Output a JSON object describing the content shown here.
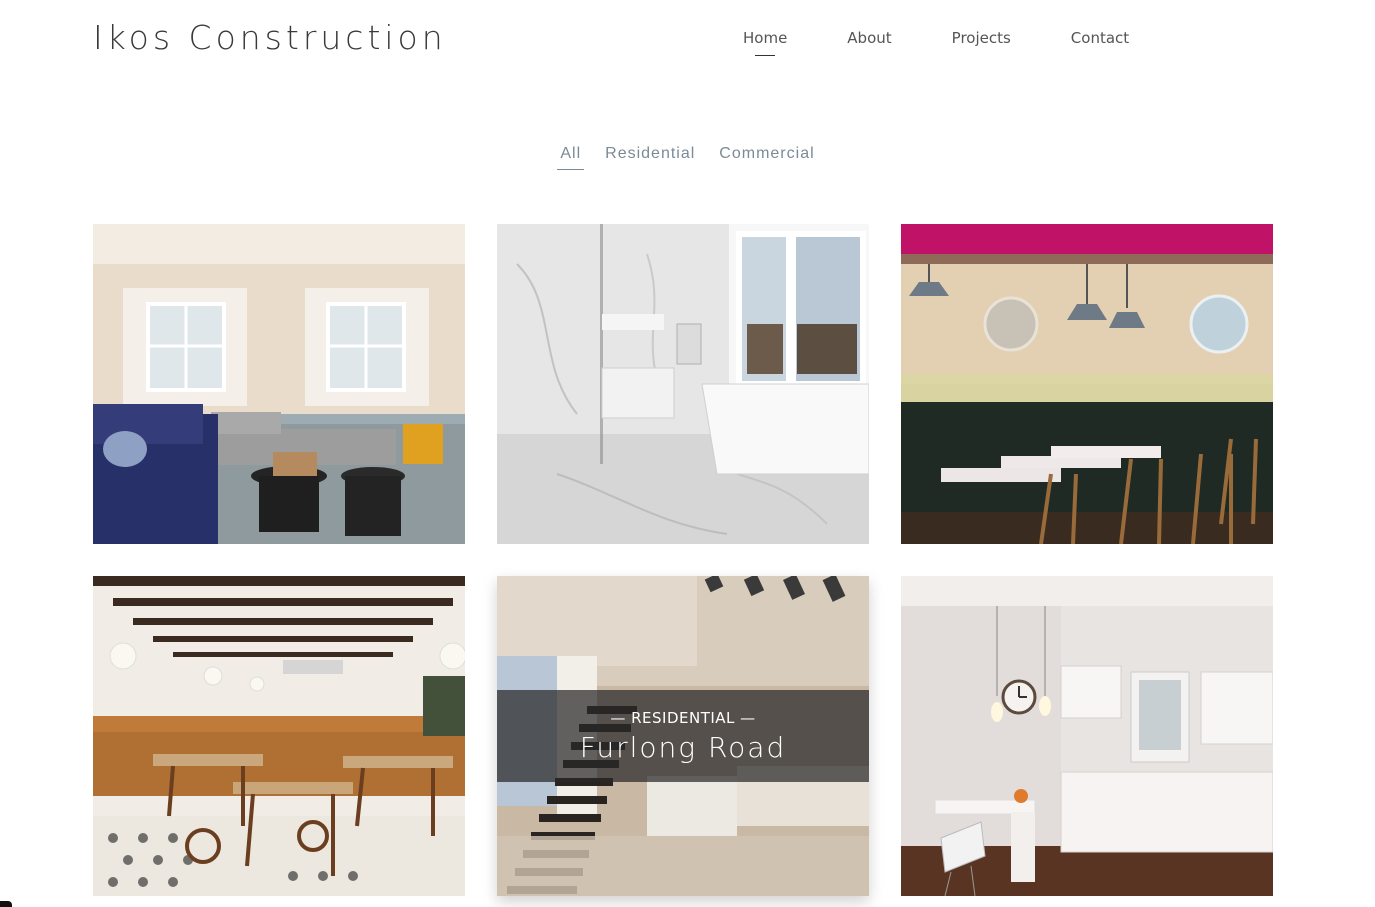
{
  "site": {
    "brand": "Ikos Construction"
  },
  "nav": {
    "items": [
      {
        "label": "Home",
        "active": true
      },
      {
        "label": "About"
      },
      {
        "label": "Projects"
      },
      {
        "label": "Contact"
      }
    ]
  },
  "filters": {
    "items": [
      {
        "label": "All",
        "active": true
      },
      {
        "label": "Residential"
      },
      {
        "label": "Commercial"
      }
    ]
  },
  "gallery": {
    "hovered": {
      "category_prefix": "— ",
      "category": "RESIDENTIAL",
      "category_suffix": " —",
      "title": "Furlong Road"
    },
    "projects": [
      {
        "image": "living-room-photo"
      },
      {
        "image": "marble-bathroom-photo"
      },
      {
        "image": "restaurant-pink-ceiling-photo"
      },
      {
        "image": "restaurant-beams-photo"
      },
      {
        "image": "staircase-basement-photo"
      },
      {
        "image": "white-kitchen-photo"
      }
    ]
  }
}
